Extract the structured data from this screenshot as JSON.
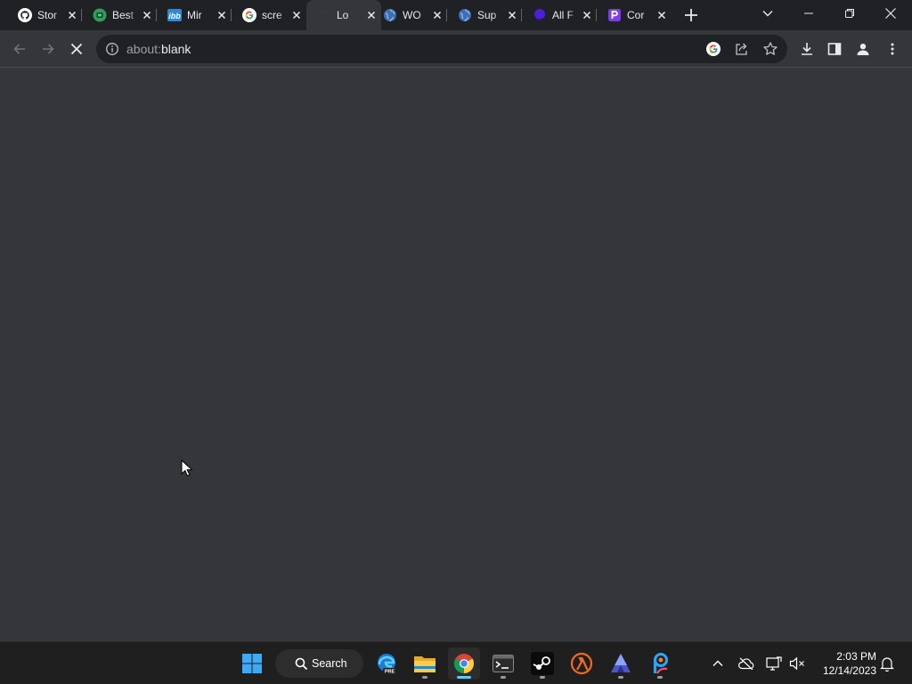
{
  "tabs": [
    {
      "title": "Stor",
      "icon": "github-icon"
    },
    {
      "title": "Best",
      "icon": "green-app-icon"
    },
    {
      "title": "Mir",
      "icon": "ibb-icon"
    },
    {
      "title": "scre",
      "icon": "google-icon"
    },
    {
      "title": "Lo",
      "icon": "loading-icon",
      "active": true
    },
    {
      "title": "WO",
      "icon": "globe-icon"
    },
    {
      "title": "Sup",
      "icon": "globe-icon"
    },
    {
      "title": "All F",
      "icon": "purple-circle-icon"
    },
    {
      "title": "Cor",
      "icon": "p-logo-icon"
    }
  ],
  "address_bar": {
    "scheme": "about:",
    "host": "blank"
  },
  "taskbar": {
    "search_label": "Search",
    "apps": [
      "edge-preview-icon",
      "file-explorer-icon",
      "chrome-icon",
      "terminal-icon",
      "steam-icon",
      "half-life-icon",
      "affinity-icon",
      "picsart-icon"
    ],
    "time": "2:03 PM",
    "date": "12/14/2023"
  },
  "colors": {
    "tabstrip": "#202124",
    "toolbar": "#35363a",
    "omnibox": "#202124",
    "taskbar": "#1f1f1f",
    "accent": "#60cdff"
  }
}
